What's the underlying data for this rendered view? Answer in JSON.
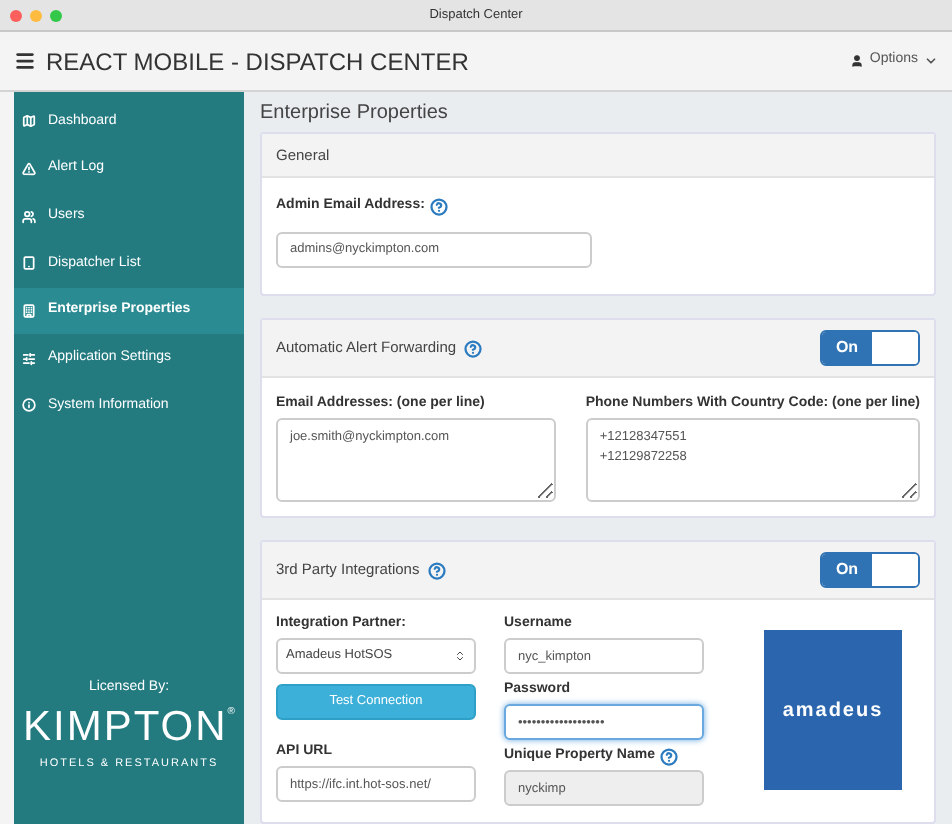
{
  "window": {
    "title": "Dispatch Center"
  },
  "header": {
    "app_title": "REACT MOBILE - DISPATCH CENTER",
    "options": "Options"
  },
  "sidebar": {
    "items": [
      {
        "label": "Dashboard",
        "selected": false
      },
      {
        "label": "Alert Log",
        "selected": false
      },
      {
        "label": "Users",
        "selected": false
      },
      {
        "label": "Dispatcher List",
        "selected": false
      },
      {
        "label": "Enterprise Properties",
        "selected": true
      },
      {
        "label": "Application Settings",
        "selected": false
      },
      {
        "label": "System Information",
        "selected": false
      }
    ],
    "licensed_by": "Licensed By:",
    "brand": "KIMPTON",
    "brand_mark": "®",
    "brand_tagline": "HOTELS & RESTAURANTS"
  },
  "page_title": "Enterprise Properties",
  "general": {
    "title": "General",
    "admin_email_label": "Admin Email Address:",
    "admin_email": "admins@nyckimpton.com"
  },
  "alert_forwarding": {
    "title": "Automatic Alert Forwarding",
    "toggle": {
      "label": "On",
      "on": true
    },
    "emails_label": "Email Addresses: (one per line)",
    "emails": "joe.smith@nyckimpton.com",
    "phones_label": "Phone Numbers With Country Code: (one per line)",
    "phones": "+12128347551\n+12129872258"
  },
  "integrations": {
    "title": "3rd Party Integrations",
    "toggle": {
      "label": "On",
      "on": true
    },
    "partner_label": "Integration Partner:",
    "partner": "Amadeus HotSOS",
    "test_button": "Test Connection",
    "api_url_label": "API URL",
    "api_url": "https://ifc.int.hot-sos.net/",
    "username_label": "Username",
    "username": "nyc_kimpton",
    "password_label": "Password",
    "password": "•••••••••••••••••••",
    "property_label": "Unique Property Name",
    "property": "nyckimp",
    "logo_text": "amadeus"
  }
}
